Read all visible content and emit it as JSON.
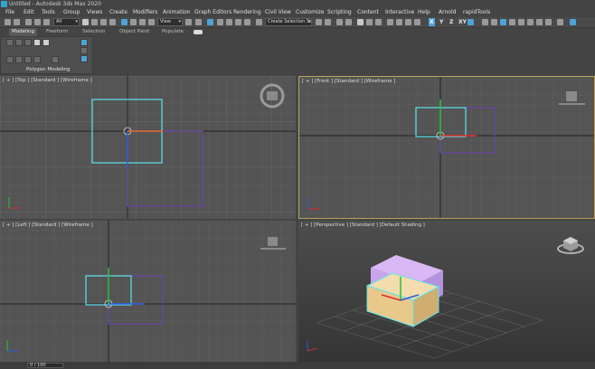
{
  "window": {
    "title": "Untitled - Autodesk 3ds Max 2020"
  },
  "menu": [
    "File",
    "Edit",
    "Tools",
    "Group",
    "Views",
    "Create",
    "Modifiers",
    "Animation",
    "Graph Editors",
    "Rendering",
    "Civil View",
    "Customize",
    "Scripting",
    "Content",
    "Interactive",
    "Help",
    "Arnold",
    "rapidTools"
  ],
  "toolbar": {
    "filter_dropdown": "All",
    "view_dropdown": "View",
    "selection_set_dropdown": "Create Selection Se",
    "axis_x": "X",
    "axis_y": "Y",
    "axis_z": "Z",
    "axis_xy": "XY",
    "axis_active": "X"
  },
  "ribbon": {
    "tabs": [
      "Modeling",
      "Freeform",
      "Selection",
      "Object Paint",
      "Populate"
    ],
    "active_tab": "Modeling",
    "panel_label": "Polygon Modeling"
  },
  "viewports": {
    "top": "[ + ] [Top ] [Standard ] [Wireframe ]",
    "front": "[ + ] [Front ] [Standard ] [Wireframe ]",
    "left": "[ + ] [Left ] [Standard ] [Wireframe ]",
    "perspective": "[ + ] [Perspective ] [Standard ] [Default Shading ]"
  },
  "status": {
    "field": "0 / 100"
  },
  "colors": {
    "selected": "#5fe3f0",
    "purple_object": "#6c3fb8",
    "persp_top_box": "#c9a6ec",
    "persp_bottom_box": "#e8c98b",
    "gizmo_y": "#28c23a",
    "gizmo_x": "#e02a2a",
    "gizmo_z": "#2a5ce0",
    "active_viewport_border": "#b8a25a"
  }
}
